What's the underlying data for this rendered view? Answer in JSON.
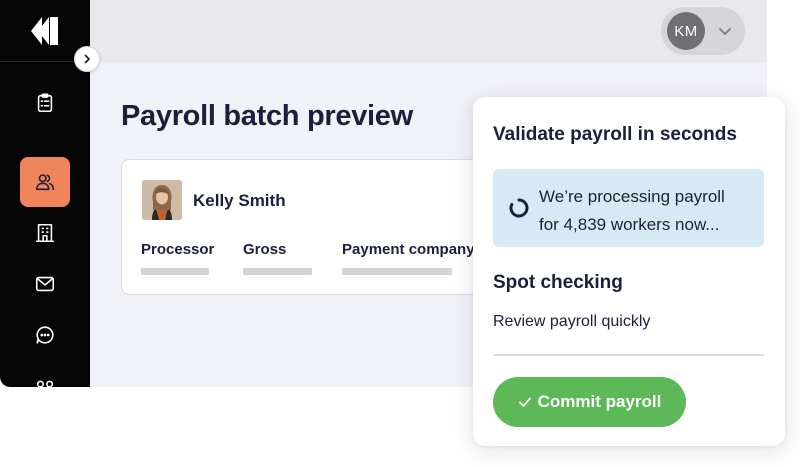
{
  "user_menu": {
    "initials": "KM"
  },
  "page": {
    "title": "Payroll batch preview"
  },
  "record": {
    "name": "Kelly Smith",
    "columns": [
      "Processor",
      "Gross",
      "Payment company"
    ]
  },
  "panel": {
    "title": "Validate payroll in seconds",
    "processing_line1": "We’re processing payroll",
    "processing_line2": "for 4,839 workers now...",
    "section_title": "Spot checking",
    "section_desc": "Review payroll quickly",
    "commit_label": "Commit payroll"
  },
  "colors": {
    "sidebar": "#050505",
    "active_nav": "#f0855b",
    "processing_bg": "#d8e9f6",
    "commit_button": "#5db957"
  },
  "icons": {
    "logo": "brand-logo",
    "collapse": "chevron-right-icon",
    "user_chevron": "chevron-down-icon",
    "spinner": "loading-spinner-icon",
    "commit": "checkmark-icon"
  }
}
